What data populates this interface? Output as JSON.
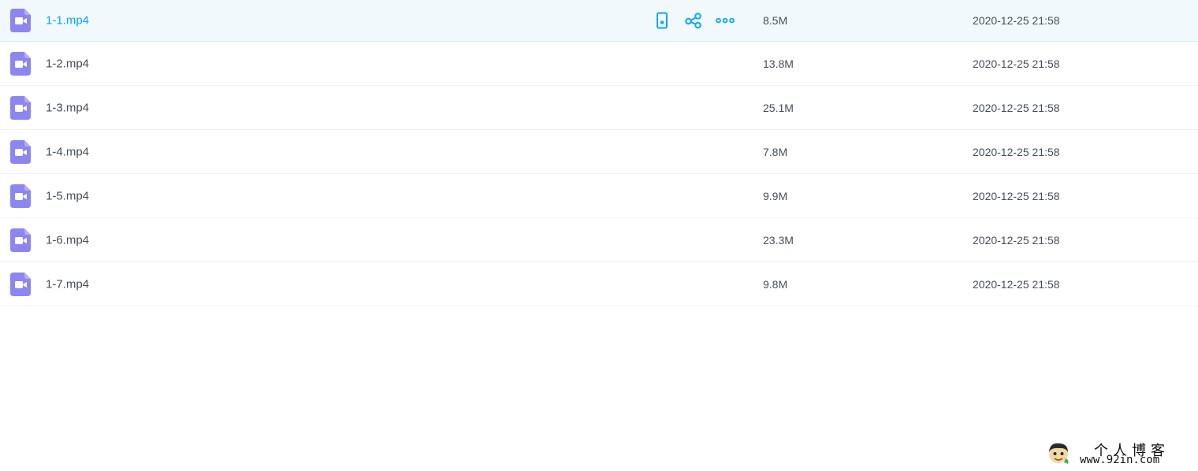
{
  "files": [
    {
      "name": "1-1.mp4",
      "size": "8.5M",
      "modified": "2020-12-25 21:58"
    },
    {
      "name": "1-2.mp4",
      "size": "13.8M",
      "modified": "2020-12-25 21:58"
    },
    {
      "name": "1-3.mp4",
      "size": "25.1M",
      "modified": "2020-12-25 21:58"
    },
    {
      "name": "1-4.mp4",
      "size": "7.8M",
      "modified": "2020-12-25 21:58"
    },
    {
      "name": "1-5.mp4",
      "size": "9.9M",
      "modified": "2020-12-25 21:58"
    },
    {
      "name": "1-6.mp4",
      "size": "23.3M",
      "modified": "2020-12-25 21:58"
    },
    {
      "name": "1-7.mp4",
      "size": "9.8M",
      "modified": "2020-12-25 21:58"
    }
  ],
  "hovered_row_actions": [
    "phone-icon",
    "share-icon",
    "more-icon"
  ],
  "watermark": {
    "title": "个人博客",
    "url": "www.92in.com"
  },
  "colors": {
    "accent": "#06a7ff",
    "text": "#454d5a",
    "hover_background": "#f1f9fd",
    "video_icon": "#8c85f4"
  }
}
